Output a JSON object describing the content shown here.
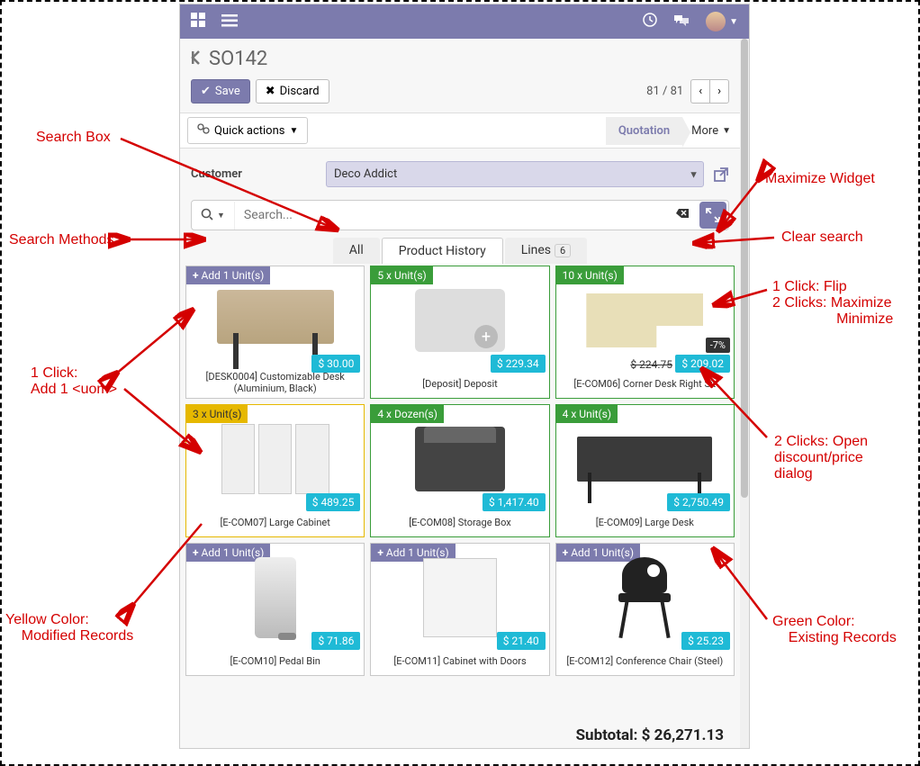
{
  "header": {
    "record": "SO142",
    "save": "Save",
    "discard": "Discard",
    "pager": "81 / 81",
    "quick_actions": "Quick actions",
    "stage_active": "Quotation",
    "more": "More"
  },
  "form": {
    "customer_label": "Customer",
    "customer_value": "Deco Addict"
  },
  "search": {
    "placeholder": "Search..."
  },
  "tabs": {
    "all": "All",
    "history": "Product History",
    "lines": "Lines",
    "lines_count": "6"
  },
  "products": [
    {
      "badge": "+ Add 1 Unit(s)",
      "badge_cls": "purple",
      "price": "$ 30.00",
      "name": "[DESK0004] Customizable Desk (Aluminium, Black)",
      "shape": "desk",
      "card": ""
    },
    {
      "badge": "5 x Unit(s)",
      "badge_cls": "green",
      "price": "$ 229.34",
      "name": "[Deposit] Deposit",
      "shape": "noimg",
      "card": "green"
    },
    {
      "badge": "10 x Unit(s)",
      "badge_cls": "green",
      "price": "$ 209.02",
      "name": "[E-COM06] Corner Desk Right Sit",
      "shape": "corner",
      "card": "green",
      "discount": "-7%",
      "strike": "$ 224.75"
    },
    {
      "badge": "3 x Unit(s)",
      "badge_cls": "yellow",
      "price": "$ 489.25",
      "name": "[E-COM07] Large Cabinet",
      "shape": "cabinet",
      "card": "yellow"
    },
    {
      "badge": "4 x Dozen(s)",
      "badge_cls": "green",
      "price": "$ 1,417.40",
      "name": "[E-COM08] Storage Box",
      "shape": "box",
      "card": "green"
    },
    {
      "badge": "4 x Unit(s)",
      "badge_cls": "green",
      "price": "$ 2,750.49",
      "name": "[E-COM09] Large Desk",
      "shape": "ldesk",
      "card": "green"
    },
    {
      "badge": "+ Add 1 Unit(s)",
      "badge_cls": "purple",
      "price": "$ 71.86",
      "name": "[E-COM10] Pedal Bin",
      "shape": "bin",
      "card": ""
    },
    {
      "badge": "+ Add 1 Unit(s)",
      "badge_cls": "purple",
      "price": "$ 21.40",
      "name": "[E-COM11] Cabinet with Doors",
      "shape": "cab2",
      "card": ""
    },
    {
      "badge": "+ Add 1 Unit(s)",
      "badge_cls": "purple",
      "price": "$ 25.23",
      "name": "[E-COM12] Conference Chair (Steel)",
      "shape": "chair",
      "card": ""
    }
  ],
  "subtotal": "Subtotal: $ 26,271.13",
  "annotations": {
    "search_box": "Search Box",
    "search_methods": "Search Methods",
    "add_one": "1 Click:\nAdd 1 <uom>",
    "yellow": "Yellow Color:\n    Modified Records",
    "maximize": "Maximize Widget",
    "clear": "Clear search",
    "flip": "1 Click: Flip\n2 Clicks: Maximize\n                Minimize",
    "discount": "2 Clicks: Open\ndiscount/price\ndialog",
    "green": "Green Color:\n    Existing Records"
  }
}
